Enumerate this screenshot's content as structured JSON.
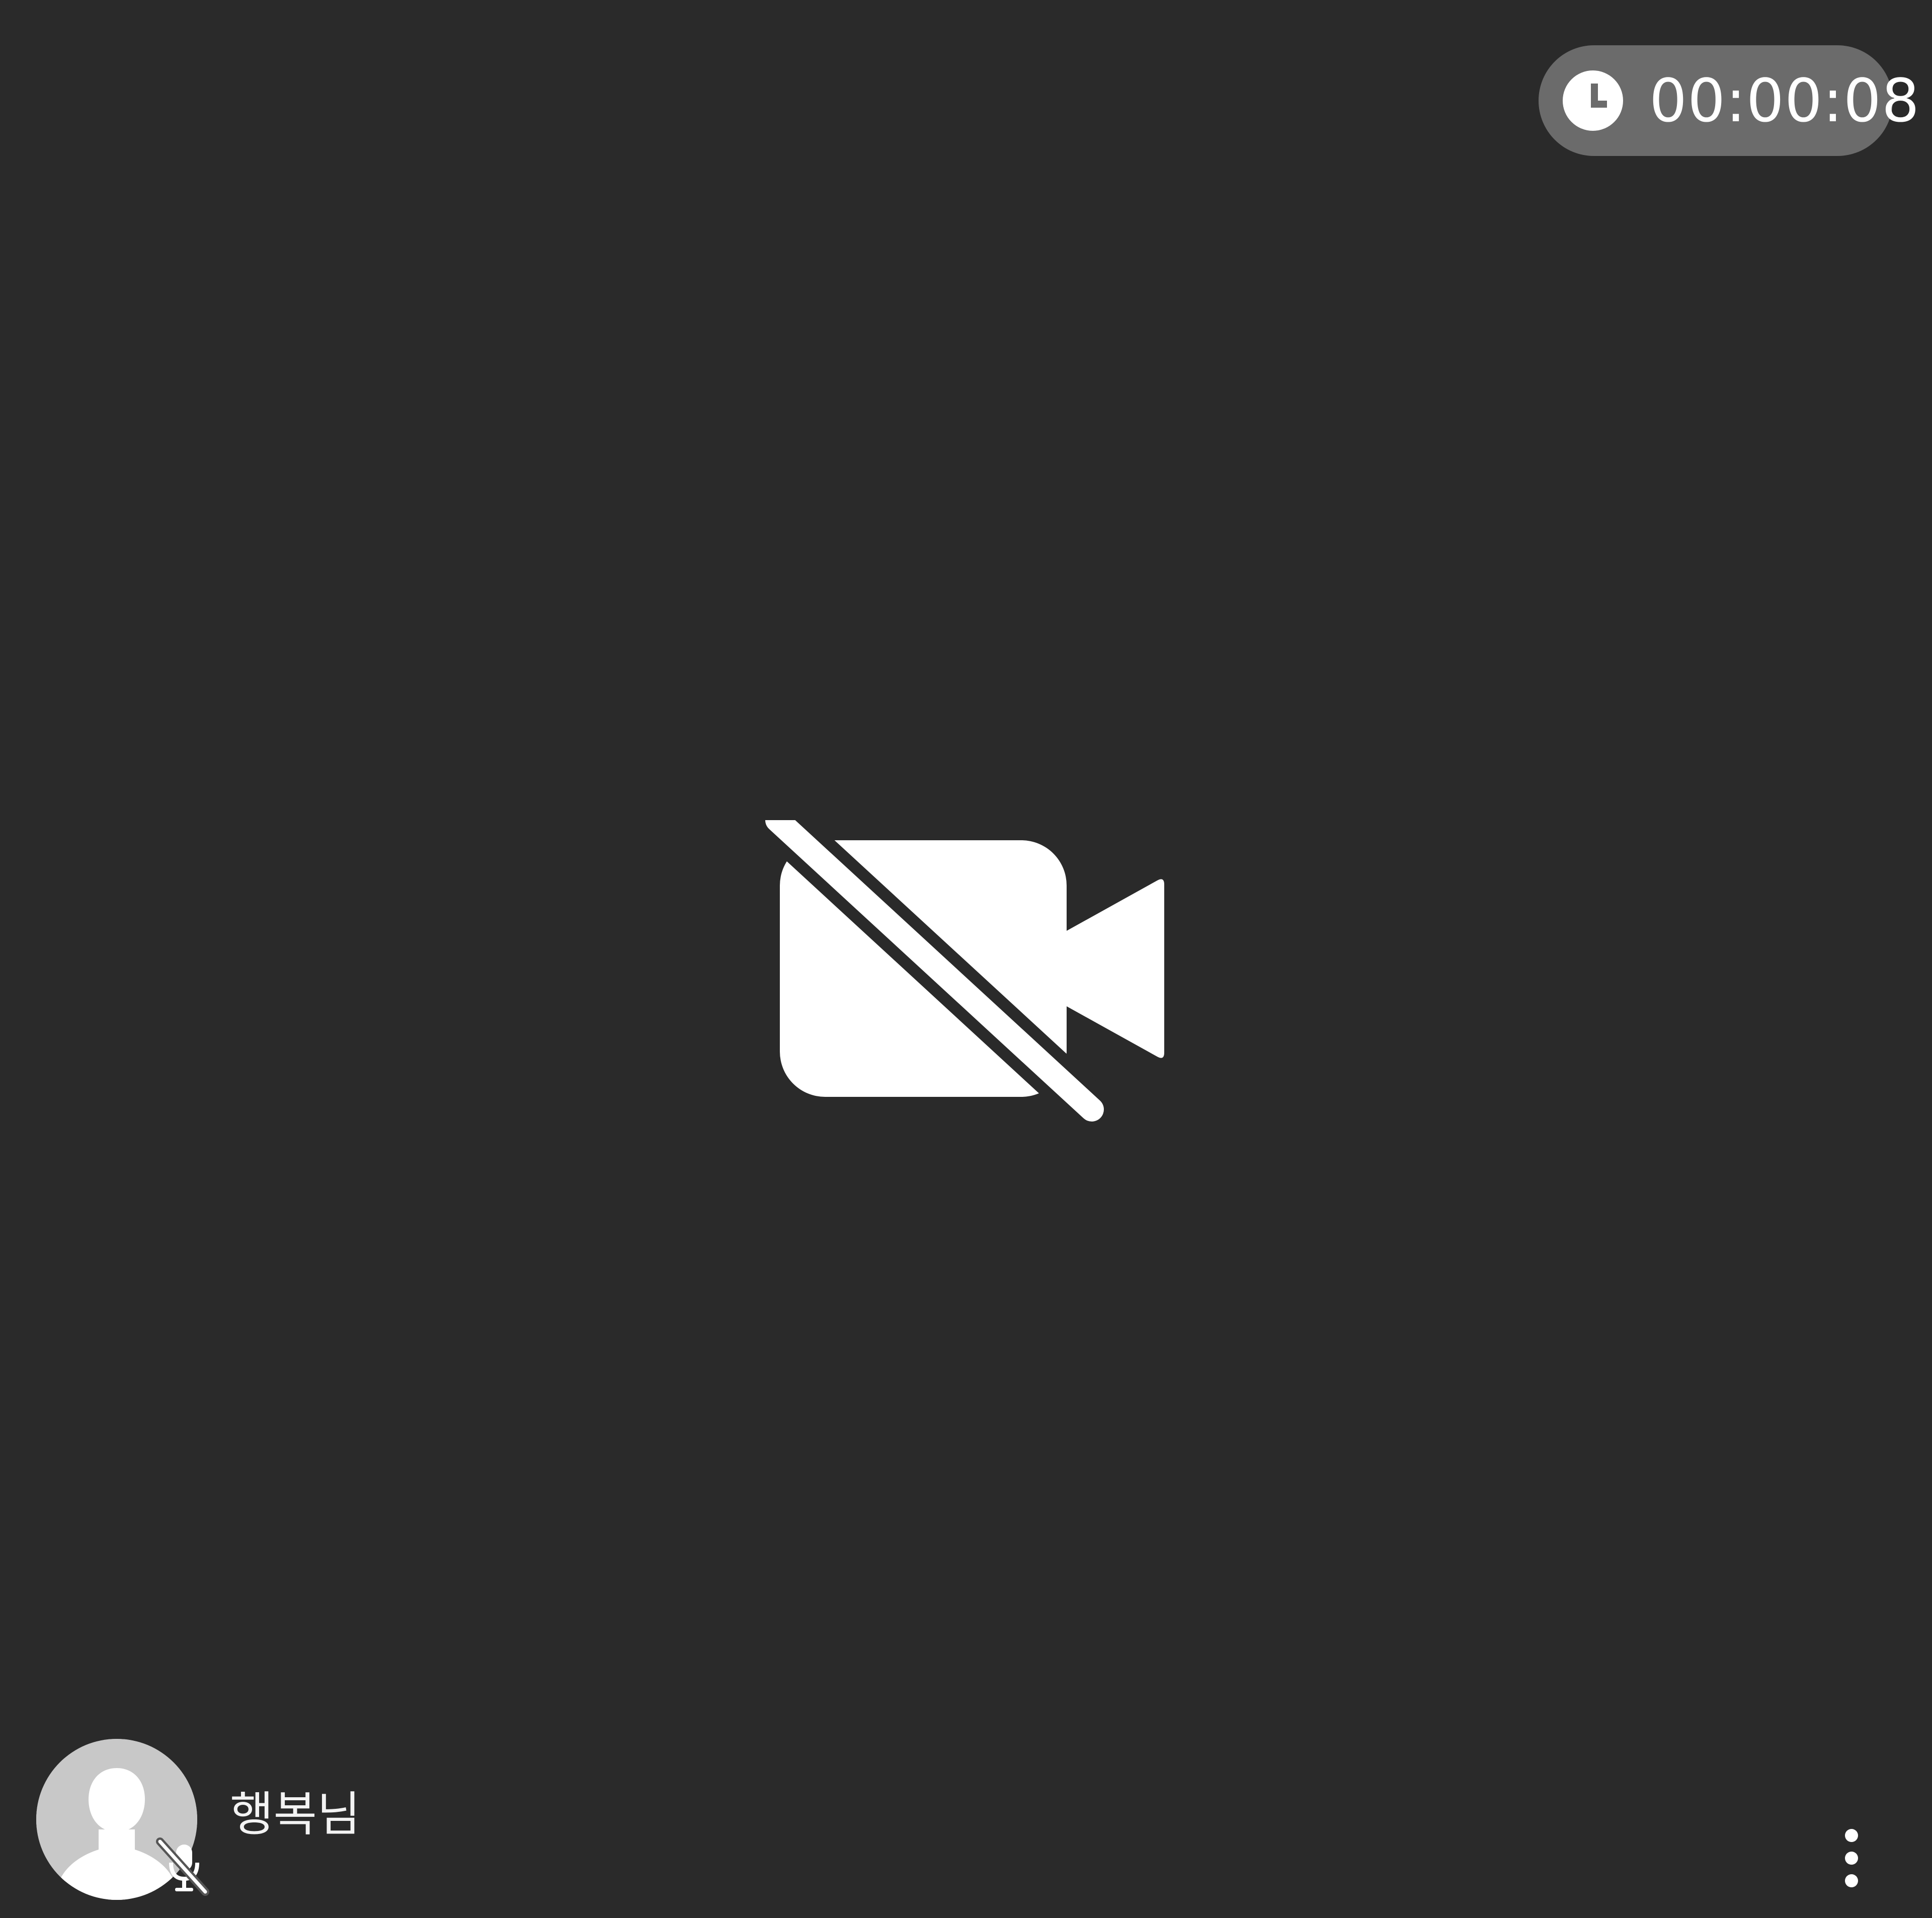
{
  "call": {
    "elapsed_time": "00:00:08",
    "video_status_icon": "camera-off-icon",
    "clock_icon": "clock-icon"
  },
  "participant": {
    "name": "행복님",
    "avatar_icon": "default-avatar-icon",
    "microphone_status_icon": "mic-off-icon",
    "menu_icon": "more-vertical-icon"
  },
  "colors": {
    "background": "#2a2a2a",
    "timer_pill": "#6b6b6b",
    "icon_white": "#ffffff",
    "avatar_gray": "#c8c8c8"
  }
}
